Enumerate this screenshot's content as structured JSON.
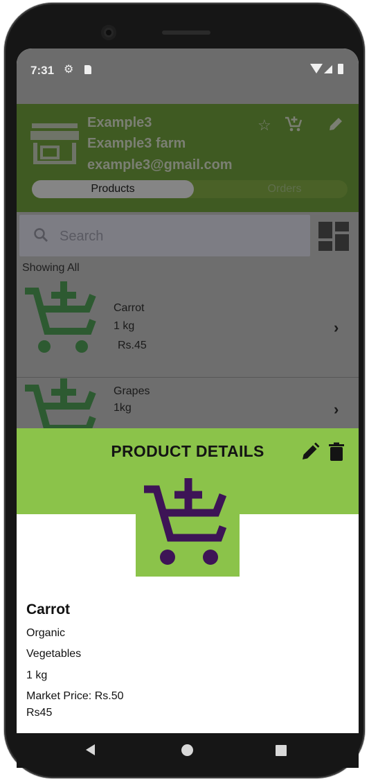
{
  "status_bar": {
    "time": "7:31"
  },
  "header": {
    "farmer_name": "Example3",
    "farm_name": "Example3 farm",
    "email": "example3@gmail.com",
    "tabs": [
      {
        "label": "Products"
      },
      {
        "label": "Orders"
      }
    ]
  },
  "search": {
    "placeholder": "Search"
  },
  "filter_label": "Showing All",
  "products": [
    {
      "name": "Carrot",
      "qty": "1 kg",
      "price": "Rs.45"
    },
    {
      "name": "Grapes",
      "qty": "1kg"
    }
  ],
  "product_details": {
    "title": "PRODUCT DETAILS",
    "name": "Carrot",
    "type": "Organic",
    "category": "Vegetables",
    "qty": "1 kg",
    "market_price": "Market Price: Rs.50",
    "price": "Rs45"
  },
  "colors": {
    "accent_green": "#8bc34a",
    "header_green_dimmed": "#3f5a22",
    "cart_icon_purple": "#3d1456",
    "cart_icon_green_dimmed": "#2d5a31"
  },
  "icons": [
    "store-icon",
    "star-icon",
    "cart-add-icon",
    "edit-icon",
    "search-icon",
    "grid-view-icon",
    "chevron-right-icon",
    "delete-icon",
    "nav-back-icon",
    "nav-home-icon",
    "nav-recents-icon"
  ]
}
